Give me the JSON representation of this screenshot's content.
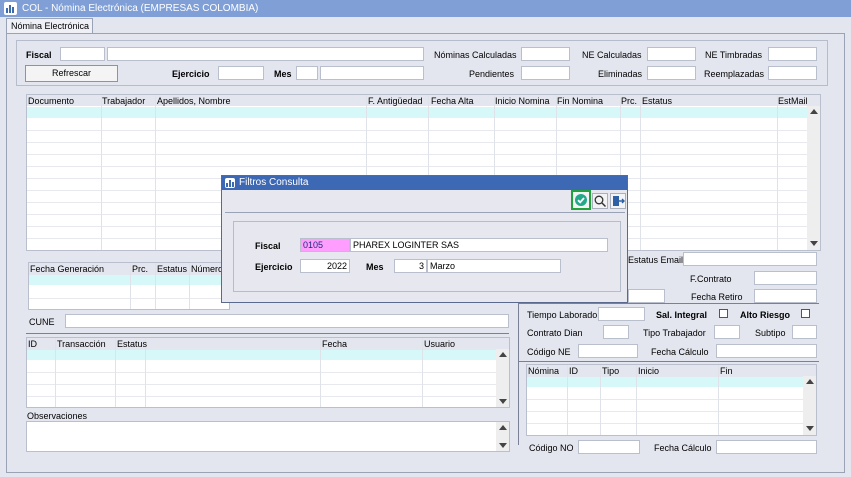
{
  "window": {
    "title": "COL - Nómina Electrónica (EMPRESAS COLOMBIA)",
    "tab": "Nómina Electrónica"
  },
  "top": {
    "fiscal_label": "Fiscal",
    "refresh_label": "Refrescar",
    "ejercicio_label": "Ejercicio",
    "mes_label": "Mes",
    "nominas_calculadas_label": "Nóminas Calculadas",
    "ne_calculadas_label": "NE Calculadas",
    "ne_timbradas_label": "NE Timbradas",
    "pendientes_label": "Pendientes",
    "eliminadas_label": "Eliminadas",
    "reemplazadas_label": "Reemplazadas"
  },
  "main_grid": {
    "columns": [
      "Documento",
      "Trabajador",
      "Apellidos, Nombre",
      "F. Antigüedad",
      "Fecha Alta",
      "Inicio Nomina",
      "Fin Nomina",
      "Prc.",
      "Estatus",
      "EstMail"
    ]
  },
  "mid_grid": {
    "columns": [
      "Fecha Generación",
      "Prc.",
      "Estatus",
      "Número"
    ]
  },
  "right_fields": {
    "estatus_email_label": "Estatus Email",
    "f_contrato_label": "F.Contrato",
    "fecha_retiro_label": "Fecha Retiro",
    "tiempo_laborado_label": "Tiempo Laborado",
    "sal_integral_label": "Sal. Integral",
    "alto_riesgo_label": "Alto Riesgo",
    "contrato_dian_label": "Contrato Dian",
    "tipo_trabajador_label": "Tipo Trabajador",
    "subtipo_label": "Subtipo",
    "codigo_ne_label": "Código NE",
    "fecha_calculo_label": "Fecha Cálculo"
  },
  "cune_label": "CUNE",
  "trans_grid": {
    "columns": [
      "ID",
      "Transacción",
      "Estatus",
      "Fecha",
      "Usuario"
    ]
  },
  "observaciones_label": "Observaciones",
  "nomina_grid": {
    "columns": [
      "Nómina",
      "ID",
      "Tipo",
      "Inicio",
      "Fin"
    ]
  },
  "bottom": {
    "codigo_no_label": "Código NO",
    "fecha_calculo_label": "Fecha Cálculo"
  },
  "dialog": {
    "title": "Filtros Consulta",
    "fiscal_label": "Fiscal",
    "fiscal_code": "0105",
    "fiscal_name": "PHAREX LOGINTER SAS",
    "ejercicio_label": "Ejercicio",
    "ejercicio_value": "2022",
    "mes_label": "Mes",
    "mes_number": "3",
    "mes_name": "Marzo"
  },
  "colors": {
    "title_bar": "#7f9fd6",
    "dialog_title": "#3d68b3",
    "grid_selection": "#d7f8f8",
    "fiscal_highlight": "#ff9eff",
    "accept_border": "#1fa33a"
  },
  "icons": [
    "app-icon",
    "accept-check-icon",
    "search-icon",
    "exit-icon"
  ]
}
